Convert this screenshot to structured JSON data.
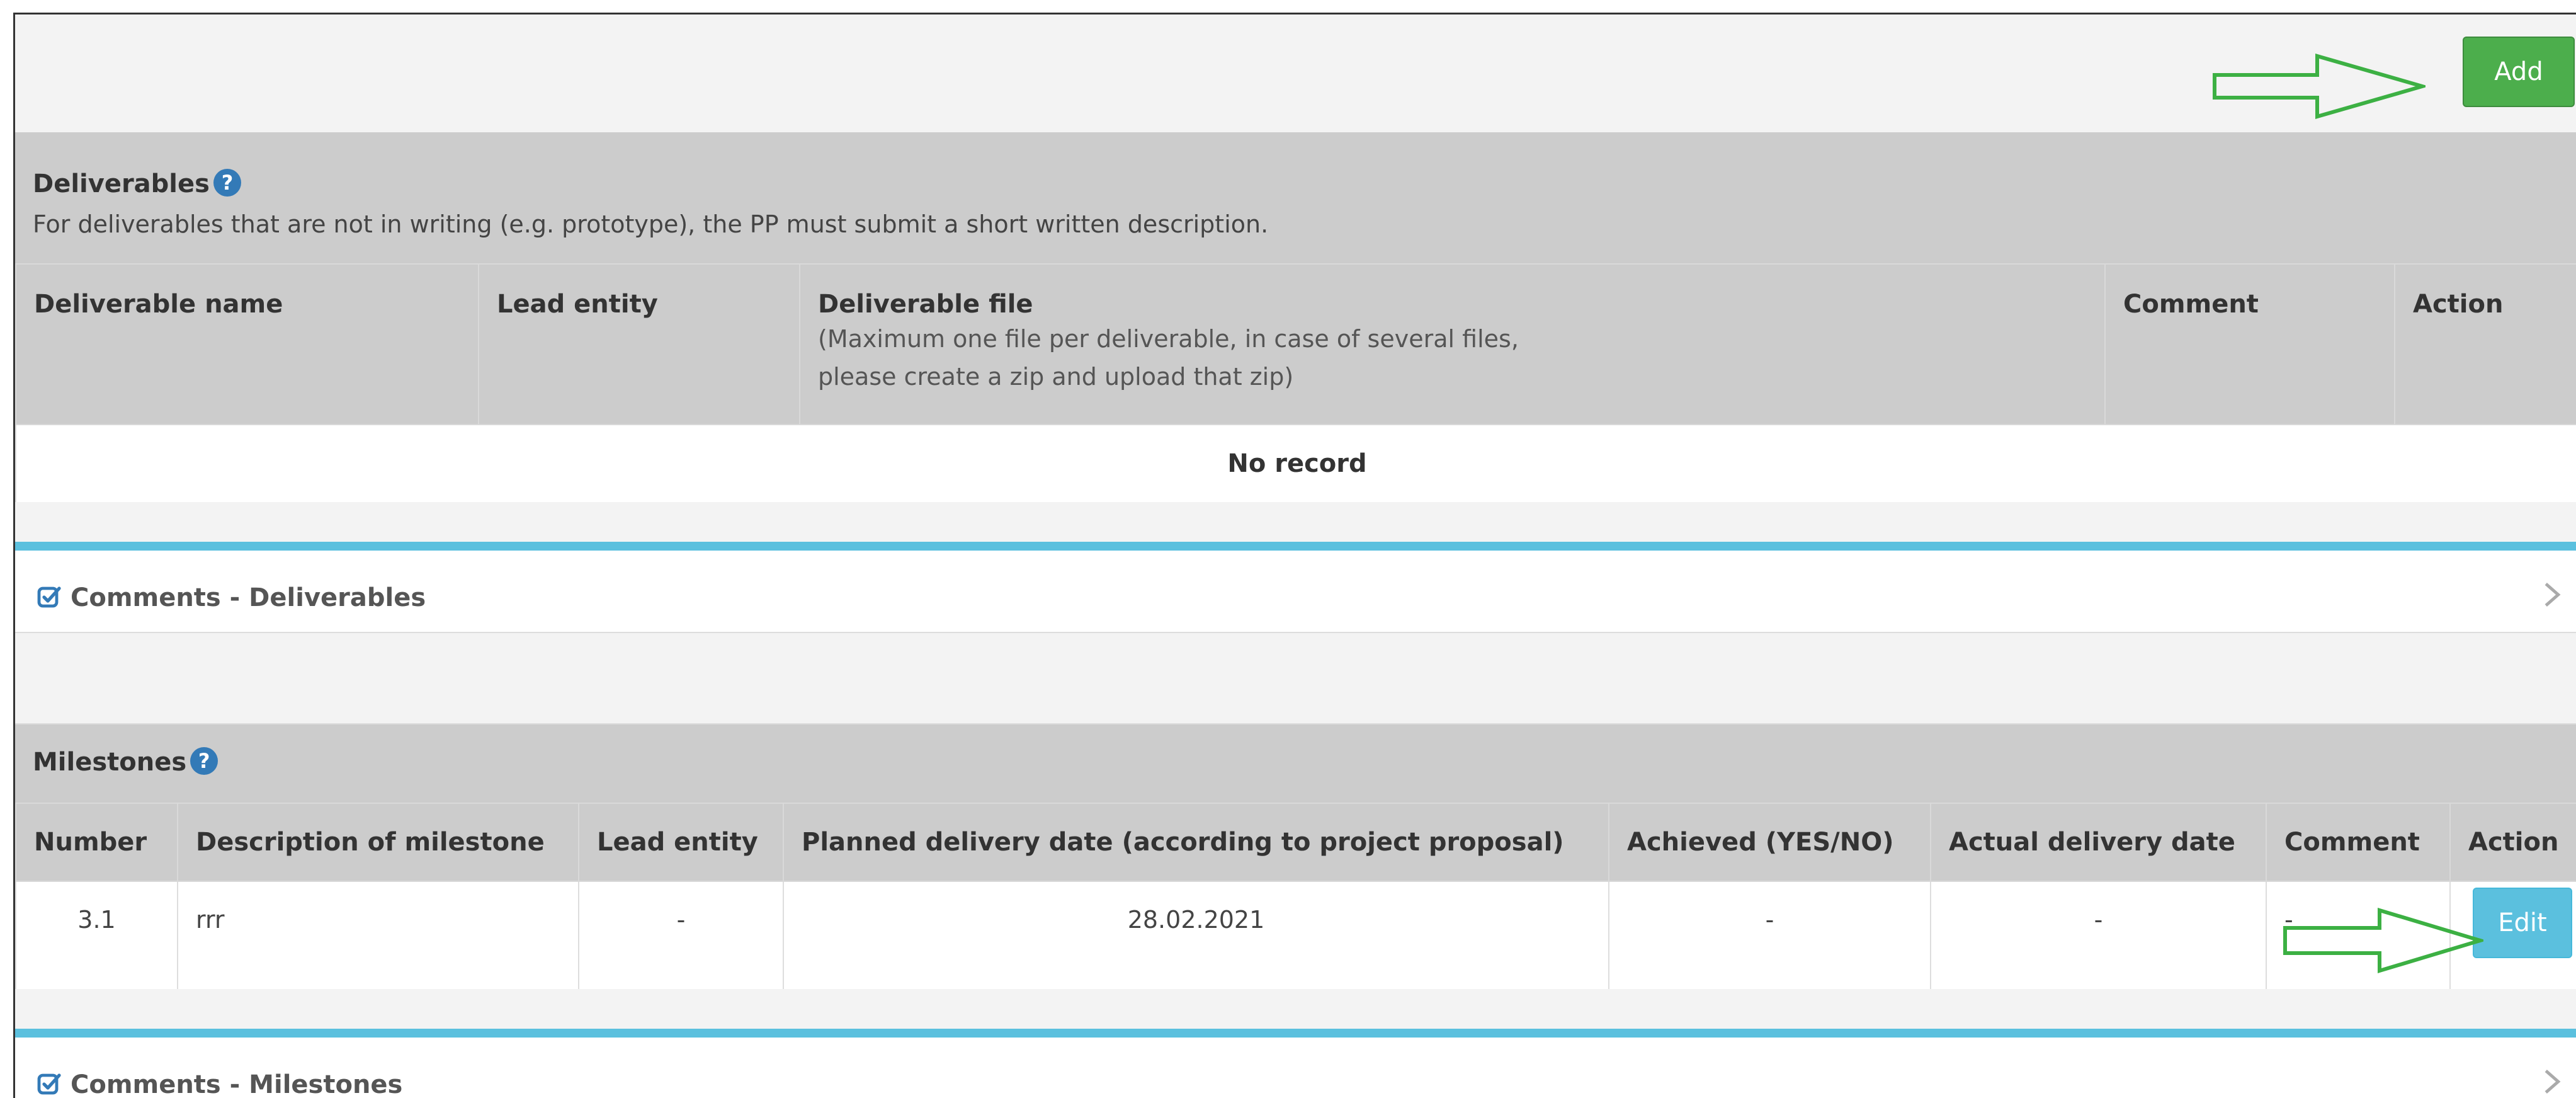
{
  "toolbar": {
    "add_label": "Add"
  },
  "deliverables": {
    "title": "Deliverables",
    "help_glyph": "?",
    "description": "For deliverables that are not in writing (e.g. prototype), the PP must submit a short written description.",
    "columns": {
      "name": "Deliverable name",
      "lead": "Lead entity",
      "file": "Deliverable file",
      "file_note_line1": "(Maximum one file per deliverable, in case of several files,",
      "file_note_line2": "please create a zip and upload that zip)",
      "comment": "Comment",
      "action": "Action"
    },
    "empty_text": "No record"
  },
  "comments_deliverables": {
    "label": "Comments - Deliverables"
  },
  "milestones": {
    "title": "Milestones",
    "help_glyph": "?",
    "columns": {
      "number": "Number",
      "description": "Description of milestone",
      "lead": "Lead entity",
      "planned": "Planned delivery date (according to project proposal)",
      "achieved": "Achieved (YES/NO)",
      "actual": "Actual delivery date",
      "comment": "Comment",
      "action": "Action"
    },
    "rows": [
      {
        "number": "3.1",
        "description": "rrr",
        "lead": "-",
        "planned": "28.02.2021",
        "achieved": "-",
        "actual": "-",
        "comment": "-",
        "edit_label": "Edit"
      }
    ]
  },
  "comments_milestones": {
    "label": "Comments - Milestones"
  },
  "colors": {
    "add_button": "#4cae4c",
    "edit_button": "#5bc0de",
    "panel_accent": "#5bc0de",
    "help_icon": "#337ab7",
    "annotation_arrow": "#3cb043"
  },
  "icons": {
    "help": "question-circle-icon",
    "check": "check-square-icon",
    "chevron": "chevron-right-icon",
    "annotation": "arrow-right-outline-icon"
  }
}
